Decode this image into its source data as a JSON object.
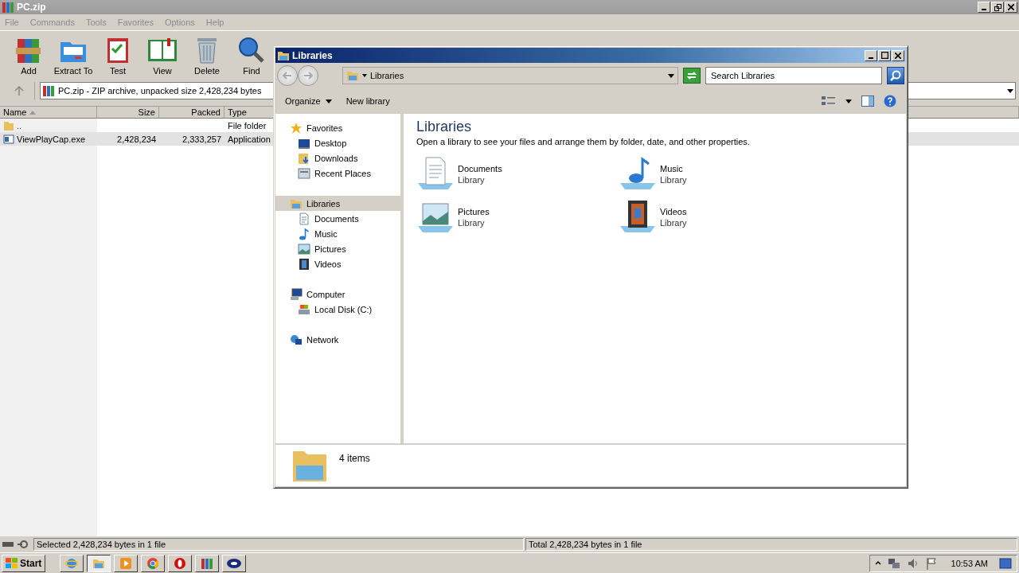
{
  "winrar": {
    "title": "PC.zip",
    "menu": [
      "File",
      "Commands",
      "Tools",
      "Favorites",
      "Options",
      "Help"
    ],
    "toolbar": [
      {
        "label": "Add",
        "kind": "add"
      },
      {
        "label": "Extract To",
        "kind": "extract"
      },
      {
        "label": "Test",
        "kind": "test"
      },
      {
        "label": "View",
        "kind": "view"
      },
      {
        "label": "Delete",
        "kind": "delete"
      },
      {
        "label": "Find",
        "kind": "find"
      }
    ],
    "path": "PC.zip - ZIP archive, unpacked size 2,428,234 bytes",
    "columns": [
      "Name",
      "Size",
      "Packed",
      "Type"
    ],
    "rows": [
      {
        "kind": "folder",
        "name": "..",
        "type": "File folder",
        "selected": false
      },
      {
        "kind": "exe",
        "name": "ViewPlayCap.exe",
        "size": "2,428,234",
        "packed": "2,333,257",
        "type": "Application",
        "selected": true
      }
    ],
    "status": [
      "Selected 2,428,234 bytes in 1 file",
      "Total 2,428,234 bytes in 1 file"
    ]
  },
  "explorer": {
    "title": "Libraries",
    "address": "Libraries",
    "search": {
      "placeholder": "Search Libraries"
    },
    "commands": [
      {
        "label": "Organize",
        "menu": true
      },
      {
        "label": "New library",
        "menu": false
      }
    ],
    "nav": [
      {
        "label": "Favorites",
        "kind": "star",
        "selected": false,
        "children": [
          {
            "label": "Desktop",
            "kind": "desktop",
            "selected": false
          },
          {
            "label": "Downloads",
            "kind": "downloads",
            "selected": false
          },
          {
            "label": "Recent Places",
            "kind": "recent",
            "selected": false
          }
        ]
      },
      {
        "label": "Libraries",
        "kind": "library",
        "selected": true,
        "children": [
          {
            "label": "Documents",
            "kind": "documents",
            "selected": false
          },
          {
            "label": "Music",
            "kind": "music",
            "selected": false
          },
          {
            "label": "Pictures",
            "kind": "pictures",
            "selected": false
          },
          {
            "label": "Videos",
            "kind": "videos",
            "selected": false
          }
        ]
      },
      {
        "label": "Computer",
        "kind": "computer",
        "selected": false,
        "children": [
          {
            "label": "Local Disk (C:)",
            "kind": "disk",
            "selected": false
          }
        ]
      },
      {
        "label": "Network",
        "kind": "network",
        "selected": false
      }
    ],
    "heading": "Libraries",
    "description": "Open a library to see your files and arrange them by folder, date, and other properties.",
    "libraries": [
      {
        "name": "Documents",
        "subtitle": "Library",
        "kind": "documents"
      },
      {
        "name": "Music",
        "subtitle": "Library",
        "kind": "music"
      },
      {
        "name": "Pictures",
        "subtitle": "Library",
        "kind": "pictures"
      },
      {
        "name": "Videos",
        "subtitle": "Library",
        "kind": "videos"
      }
    ],
    "count": "4 items"
  },
  "taskbar": {
    "start": "Start",
    "apps": [
      {
        "kind": "ie",
        "selected": false
      },
      {
        "kind": "folder",
        "selected": true
      },
      {
        "kind": "media",
        "selected": false
      },
      {
        "kind": "chrome",
        "selected": false
      },
      {
        "kind": "opera",
        "selected": false
      },
      {
        "kind": "winrar",
        "selected": false
      },
      {
        "kind": "oval",
        "selected": false
      }
    ],
    "clock": "10:53 AM"
  }
}
